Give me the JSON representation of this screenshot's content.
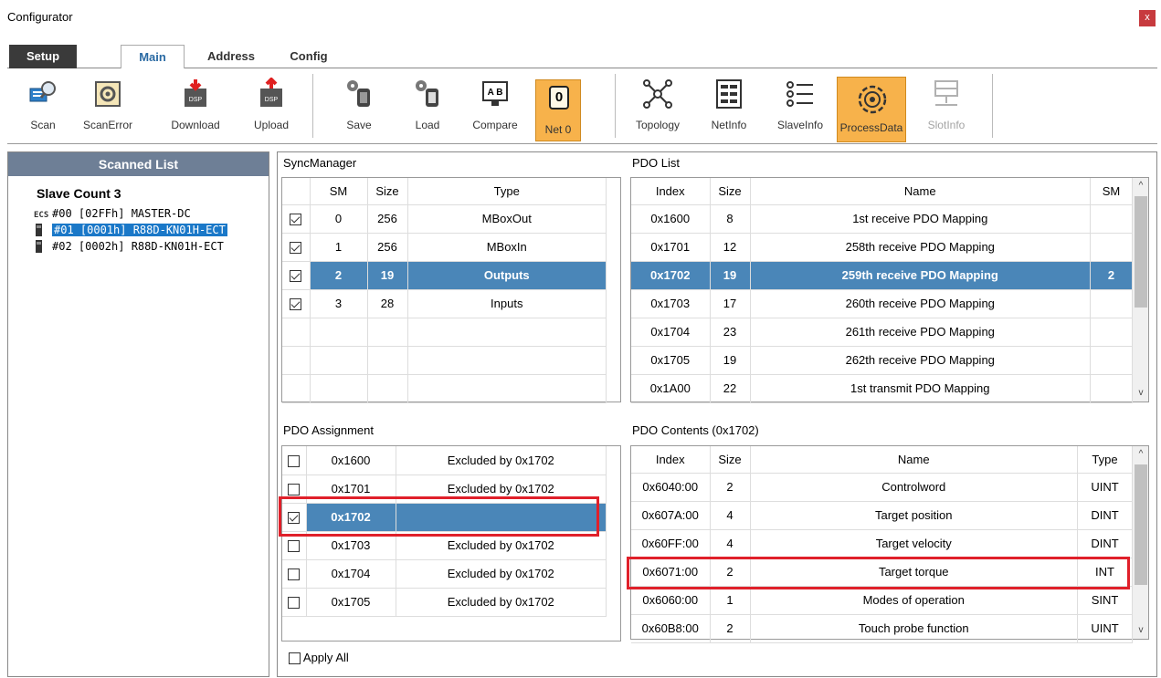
{
  "window": {
    "title": "Configurator",
    "close_label": "x"
  },
  "tabs": [
    {
      "label": "Setup"
    },
    {
      "label": "Main"
    },
    {
      "label": "Address"
    },
    {
      "label": "Config"
    }
  ],
  "toolbar": {
    "scan": "Scan",
    "scan_error": "ScanError",
    "download": "Download",
    "upload": "Upload",
    "save": "Save",
    "load": "Load",
    "compare": "Compare",
    "net_number": "0",
    "net_label": "Net 0",
    "topology": "Topology",
    "netinfo": "NetInfo",
    "slaveinfo": "SlaveInfo",
    "processdata": "ProcessData",
    "slotinfo": "SlotInfo",
    "dsp_badge": "DSP",
    "compare_badge": "A B"
  },
  "scanned_list": {
    "header": "Scanned List",
    "slave_count": "Slave Count  3",
    "ecs_badge": "ECS",
    "items": [
      {
        "label": "#00  [02FFh] MASTER-DC"
      },
      {
        "label": "#01  [0001h] R88D-KN01H-ECT"
      },
      {
        "label": "#02  [0002h] R88D-KN01H-ECT"
      }
    ]
  },
  "sync_manager": {
    "title": "SyncManager",
    "columns": [
      "",
      "SM",
      "Size",
      "Type"
    ],
    "rows": [
      {
        "checked": true,
        "sm": "0",
        "size": "256",
        "type": "MBoxOut"
      },
      {
        "checked": true,
        "sm": "1",
        "size": "256",
        "type": "MBoxIn"
      },
      {
        "checked": true,
        "sm": "2",
        "size": "19",
        "type": "Outputs"
      },
      {
        "checked": true,
        "sm": "3",
        "size": "28",
        "type": "Inputs"
      }
    ]
  },
  "pdo_list": {
    "title": "PDO List",
    "columns": [
      "Index",
      "Size",
      "Name",
      "SM"
    ],
    "rows": [
      {
        "index": "0x1600",
        "size": "8",
        "name": "1st receive PDO Mapping",
        "sm": ""
      },
      {
        "index": "0x1701",
        "size": "12",
        "name": "258th receive PDO Mapping",
        "sm": ""
      },
      {
        "index": "0x1702",
        "size": "19",
        "name": "259th receive PDO Mapping",
        "sm": "2"
      },
      {
        "index": "0x1703",
        "size": "17",
        "name": "260th receive PDO Mapping",
        "sm": ""
      },
      {
        "index": "0x1704",
        "size": "23",
        "name": "261th receive PDO Mapping",
        "sm": ""
      },
      {
        "index": "0x1705",
        "size": "19",
        "name": "262th receive PDO Mapping",
        "sm": ""
      },
      {
        "index": "0x1A00",
        "size": "22",
        "name": "1st transmit PDO Mapping",
        "sm": ""
      }
    ]
  },
  "pdo_assignment": {
    "title": "PDO Assignment",
    "rows": [
      {
        "checked": false,
        "index": "0x1600",
        "note": "Excluded by 0x1702"
      },
      {
        "checked": false,
        "index": "0x1701",
        "note": "Excluded by 0x1702"
      },
      {
        "checked": true,
        "index": "0x1702",
        "note": ""
      },
      {
        "checked": false,
        "index": "0x1703",
        "note": "Excluded by 0x1702"
      },
      {
        "checked": false,
        "index": "0x1704",
        "note": "Excluded by 0x1702"
      },
      {
        "checked": false,
        "index": "0x1705",
        "note": "Excluded by 0x1702"
      }
    ],
    "apply_all": "Apply All"
  },
  "pdo_contents": {
    "title": "PDO Contents (0x1702)",
    "columns": [
      "Index",
      "Size",
      "Name",
      "Type"
    ],
    "rows": [
      {
        "index": "0x6040:00",
        "size": "2",
        "name": "Controlword",
        "type": "UINT"
      },
      {
        "index": "0x607A:00",
        "size": "4",
        "name": "Target position",
        "type": "DINT"
      },
      {
        "index": "0x60FF:00",
        "size": "4",
        "name": "Target velocity",
        "type": "DINT"
      },
      {
        "index": "0x6071:00",
        "size": "2",
        "name": "Target torque",
        "type": "INT"
      },
      {
        "index": "0x6060:00",
        "size": "1",
        "name": "Modes of operation",
        "type": "SINT"
      },
      {
        "index": "0x60B8:00",
        "size": "2",
        "name": "Touch probe function",
        "type": "UINT"
      }
    ]
  },
  "colors": {
    "selection": "#4a86b8",
    "highlight_box": "#e0202a",
    "active_button": "#f7b24b",
    "header_bg": "#6e7f96"
  },
  "icons": {
    "scroll_up": "^",
    "scroll_down": "v"
  }
}
